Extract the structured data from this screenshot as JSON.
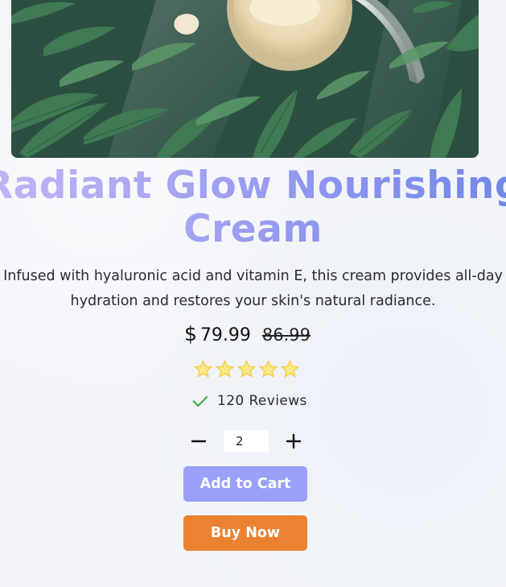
{
  "product": {
    "title": "Radiant Glow Nourishing Cream",
    "description": "Infused with hyaluronic acid and vitamin E, this cream provides all-day hydration and restores your skin's natural radiance.",
    "currency_symbol": "$",
    "price": "79.99",
    "original_price": "86.99",
    "rating": 5,
    "rating_max": 5,
    "reviews_label": "120 Reviews"
  },
  "quantity": {
    "value": "2",
    "decrement_icon": "minus-icon",
    "increment_icon": "plus-icon"
  },
  "actions": {
    "add_to_cart_label": "Add to Cart",
    "buy_now_label": "Buy Now"
  },
  "colors": {
    "title_gradient_start": "#c4b5f7",
    "title_gradient_end": "#6e86e6",
    "add_to_cart_bg": "#9aa0f7",
    "buy_now_bg": "#eb8232",
    "star": "#f7dd5e",
    "check": "#4caf50"
  },
  "icons": {
    "hero_image": "cream-jar-with-leaves-image",
    "star": "star-icon",
    "verified": "check-icon"
  }
}
